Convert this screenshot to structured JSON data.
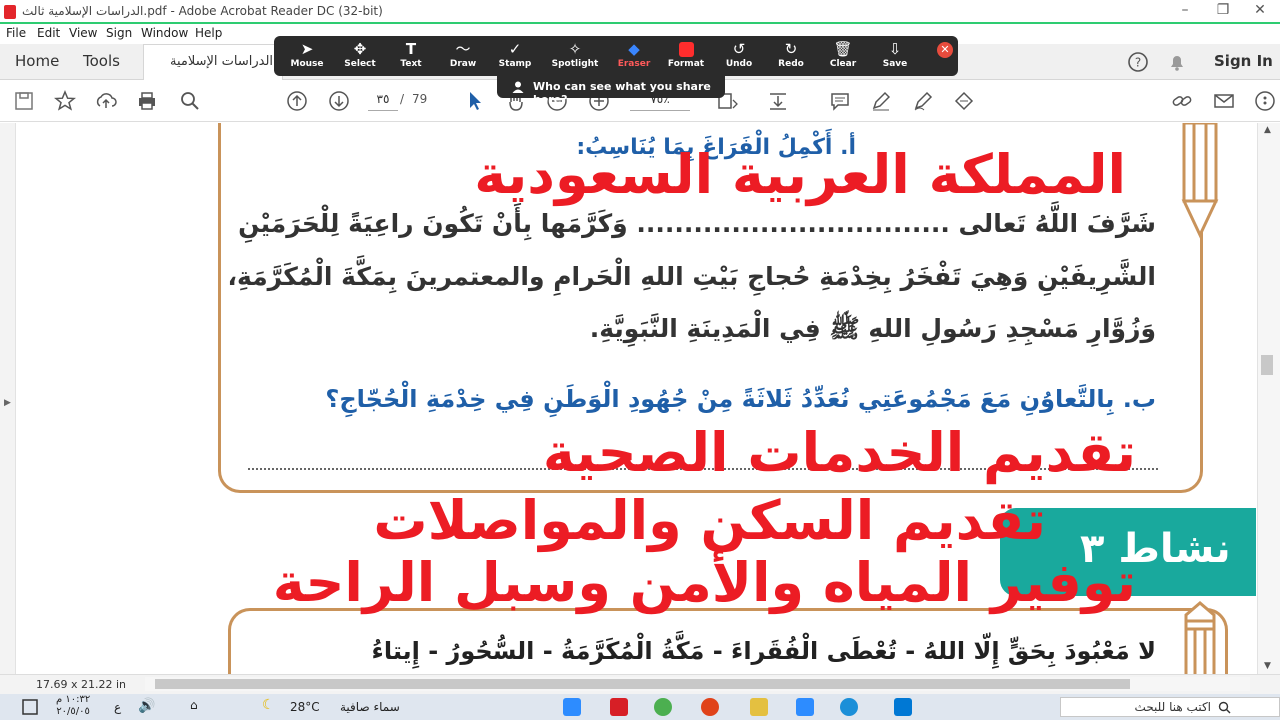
{
  "window": {
    "title": "الدراسات الإسلامية ثالث.pdf - Adobe Acrobat Reader DC (32-bit)"
  },
  "menu": [
    "File",
    "Edit",
    "View",
    "Sign",
    "Window",
    "Help"
  ],
  "tabs": {
    "home": "Home",
    "tools": "Tools",
    "doc": "الدراسات الإسلامية ...",
    "sign_in": "Sign In"
  },
  "toolbar": {
    "page_current": "٣٥",
    "page_separator": "/",
    "page_total": "79",
    "zoom": "٧٥٪"
  },
  "zoom_overlay": {
    "buttons": [
      {
        "label": "Mouse",
        "icon": "cursor-icon"
      },
      {
        "label": "Select",
        "icon": "move-icon"
      },
      {
        "label": "Text",
        "icon": "text-icon"
      },
      {
        "label": "Draw",
        "icon": "draw-icon"
      },
      {
        "label": "Stamp",
        "icon": "check-icon"
      },
      {
        "label": "Spotlight",
        "icon": "spotlight-icon"
      },
      {
        "label": "Eraser",
        "icon": "eraser-icon"
      },
      {
        "label": "Format",
        "icon": "format-icon"
      },
      {
        "label": "Undo",
        "icon": "undo-icon"
      },
      {
        "label": "Redo",
        "icon": "redo-icon"
      },
      {
        "label": "Clear",
        "icon": "trash-icon"
      },
      {
        "label": "Save",
        "icon": "save-icon"
      }
    ],
    "share_prompt": "Who can see what you share here?"
  },
  "document": {
    "question_a": "أ. أَكْمِلُ الْفَرَاغَ بِمَا يُنَاسِبُ:",
    "para_line1": "شَرَّفَ اللَّهُ تَعالى ................................. وَكَرَّمَها بِأَنْ تَكُونَ راعِيَةً لِلْحَرَمَيْنِ",
    "para_line2": "الشَّرِيفَيْنِ وَهِيَ تَفْخَرُ بِخِدْمَةِ حُجاجِ بَيْتِ اللهِ الْحَرامِ والمعتمرينَ بِمَكَّةَ الْمُكَرَّمَةِ،",
    "para_line3": "وَزُوَّارِ مَسْجِدِ رَسُولِ اللهِ ﷺ فِي الْمَدِينَةِ النَّبَوِيَّةِ.",
    "question_b": "ب. بِالتَّعاوُنِ مَعَ مَجْمُوعَتِي نُعَدِّدُ ثَلاثَةً مِنْ جُهُودِ الْوَطَنِ فِي خِدْمَةِ الْحُجّاجِ؟",
    "activity_label": "نشاط ٣",
    "bottom_line": "لا مَعْبُودَ بِحَقٍّ إِلّا اللهُ - تُعْطَى الْفُقَراءَ - مَكَّةُ الْمُكَرَّمَةُ - السُّحُورُ - إِيتاءُ"
  },
  "annotations": {
    "answer_a": "المملكة العربية السعودية",
    "answer_b1": "تقديم الخدمات الصحية",
    "answer_b2": "تقديم السكن والمواصلات",
    "answer_b3": "توفير المياه والأمن وسبل الراحة"
  },
  "status": {
    "page_size": "17.69 x 21.22 in"
  },
  "taskbar": {
    "time": "١٠:٣٢ م",
    "date": "٢٠/٥/٠٥",
    "lang": "ع",
    "temperature": "28°C",
    "weather": "سماء صافية",
    "search_placeholder": "اكتب هنا للبحث"
  },
  "colors": {
    "annotation_red": "#ec1c24",
    "frame_brown": "#c9935a",
    "question_blue": "#1f5fa8",
    "activity_teal": "#19a99d"
  }
}
